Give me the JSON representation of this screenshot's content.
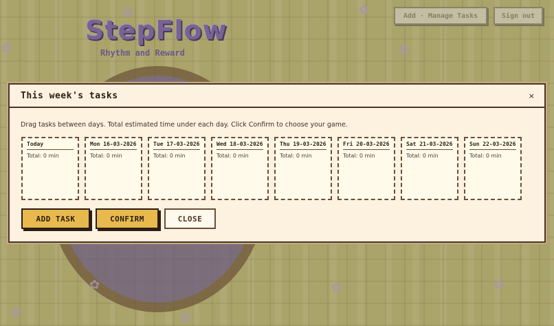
{
  "app": {
    "logo": "StepFlow",
    "tagline": "Rhythm and Reward",
    "top_buttons": [
      "Add · Manage Tasks",
      "Sign out"
    ]
  },
  "modal": {
    "title": "This week's tasks",
    "close_glyph": "×",
    "instructions": "Drag tasks between days. Total estimated time under each day. Click Confirm to choose your game.",
    "days": [
      {
        "name": "Today",
        "total": "Total: 0 min"
      },
      {
        "name": "Mon 16-03-2026",
        "total": "Total: 0 min"
      },
      {
        "name": "Tue 17-03-2026",
        "total": "Total: 0 min"
      },
      {
        "name": "Wed 18-03-2026",
        "total": "Total: 0 min"
      },
      {
        "name": "Thu 19-03-2026",
        "total": "Total: 0 min"
      },
      {
        "name": "Fri 20-03-2026",
        "total": "Total: 0 min"
      },
      {
        "name": "Sat 21-03-2026",
        "total": "Total: 0 min"
      },
      {
        "name": "Sun 22-03-2026",
        "total": "Total: 0 min"
      }
    ],
    "buttons": {
      "add_task": "ADD TASK",
      "confirm": "CONFIRM",
      "close": "CLOSE"
    }
  },
  "colors": {
    "accent": "#e8b94c",
    "border": "#4a3526",
    "modal_bg": "#fdf2df",
    "logo": "#7a63a8"
  }
}
